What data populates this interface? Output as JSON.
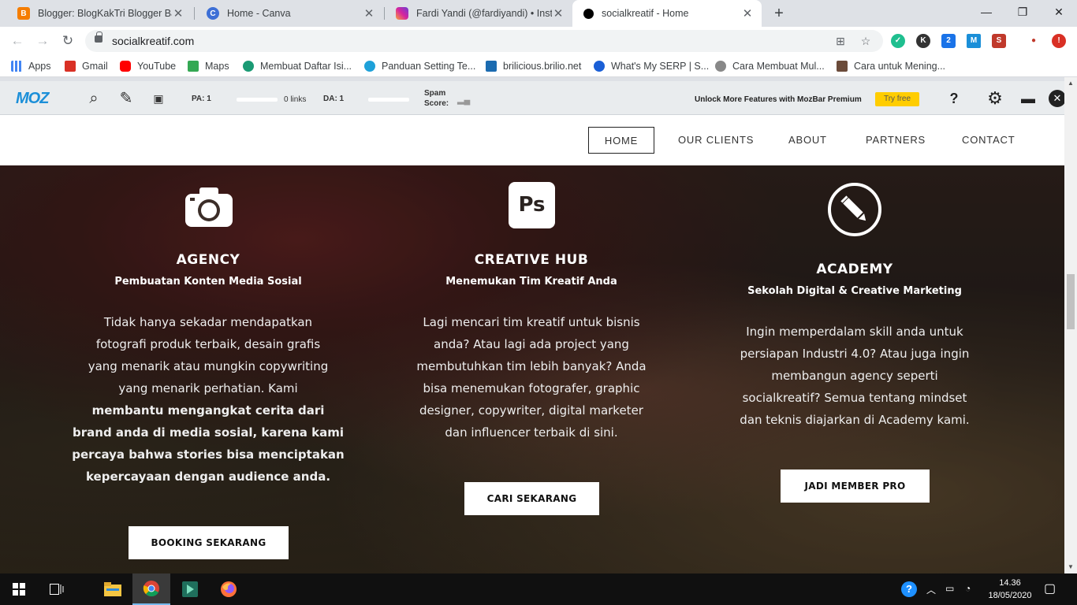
{
  "browser": {
    "tabs": [
      {
        "title": "Blogger: BlogKakTri Blogger Banj",
        "favicon_color": "#f57d00",
        "favicon_glyph": "B",
        "active": false
      },
      {
        "title": "Home - Canva",
        "favicon_color": "#3d6fd6",
        "favicon_glyph": "C",
        "active": false
      },
      {
        "title": "Fardi Yandi (@fardiyandi) • Instag",
        "favicon_color": "#d6249f",
        "favicon_glyph": "",
        "active": false
      },
      {
        "title": "socialkreatif - Home",
        "favicon_color": "#000000",
        "favicon_glyph": "",
        "active": true
      }
    ],
    "url": "socialkreatif.com",
    "bookmarks": [
      {
        "label": "Apps",
        "color": "#4285f4"
      },
      {
        "label": "Gmail",
        "color": "#d93025"
      },
      {
        "label": "YouTube",
        "color": "#ff0000"
      },
      {
        "label": "Maps",
        "color": "#34a853"
      },
      {
        "label": "Membuat Daftar Isi...",
        "color": "#1a9a74"
      },
      {
        "label": "Panduan Setting Te...",
        "color": "#1ea1d9"
      },
      {
        "label": "brilicious.brilio.net",
        "color": "#1b6bb0"
      },
      {
        "label": "What's My SERP | S...",
        "color": "#1a5fd6"
      },
      {
        "label": "Cara Membuat Mul...",
        "color": "#888888"
      },
      {
        "label": "Cara untuk Mening...",
        "color": "#6b4b3a"
      }
    ]
  },
  "mozbar": {
    "logo": "MOZ",
    "pa_label": "PA: 1",
    "links_label": "0 links",
    "da_label": "DA: 1",
    "spam_label_1": "Spam",
    "spam_label_2": "Score:",
    "promo": "Unlock More Features with MozBar Premium",
    "try_free": "Try free",
    "help_glyph": "?"
  },
  "site": {
    "nav": [
      "HOME",
      "OUR CLIENTS",
      "ABOUT",
      "PARTNERS",
      "CONTACT"
    ],
    "columns": [
      {
        "icon": "camera-icon",
        "title": "AGENCY",
        "subtitle": "Pembuatan Konten Media Sosial",
        "body_lines": [
          "Tidak hanya sekadar mendapatkan",
          "fotografi produk terbaik, desain grafis",
          "yang menarik atau mungkin copywriting",
          "yang menarik perhatian. Kami",
          "membantu mengangkat cerita dari",
          "brand anda di media sosial, karena kami",
          "percaya bahwa stories bisa menciptakan",
          "kepercayaan dengan audience anda."
        ],
        "button": "BOOKING SEKARANG"
      },
      {
        "icon": "photoshop-icon",
        "icon_text": "Ps",
        "title": "CREATIVE HUB",
        "subtitle": "Menemukan Tim Kreatif Anda",
        "body_lines": [
          "Lagi mencari tim kreatif untuk bisnis",
          "anda? Atau lagi ada project yang",
          "membutuhkan tim lebih banyak? Anda",
          "bisa menemukan fotografer, graphic",
          "designer, copywriter, digital marketer",
          "dan influencer terbaik di sini."
        ],
        "button": "CARI SEKARANG"
      },
      {
        "icon": "pencil-icon",
        "title": "ACADEMY",
        "subtitle": "Sekolah Digital & Creative Marketing",
        "body_lines": [
          "Ingin memperdalam skill anda untuk",
          "persiapan Industri 4.0? Atau juga ingin",
          "membangun agency seperti",
          "socialkreatif? Semua tentang mindset",
          "dan teknis diajarkan di Academy kami."
        ],
        "button": "JADI MEMBER PRO"
      }
    ]
  },
  "taskbar": {
    "time": "14.36",
    "date": "18/05/2020"
  }
}
